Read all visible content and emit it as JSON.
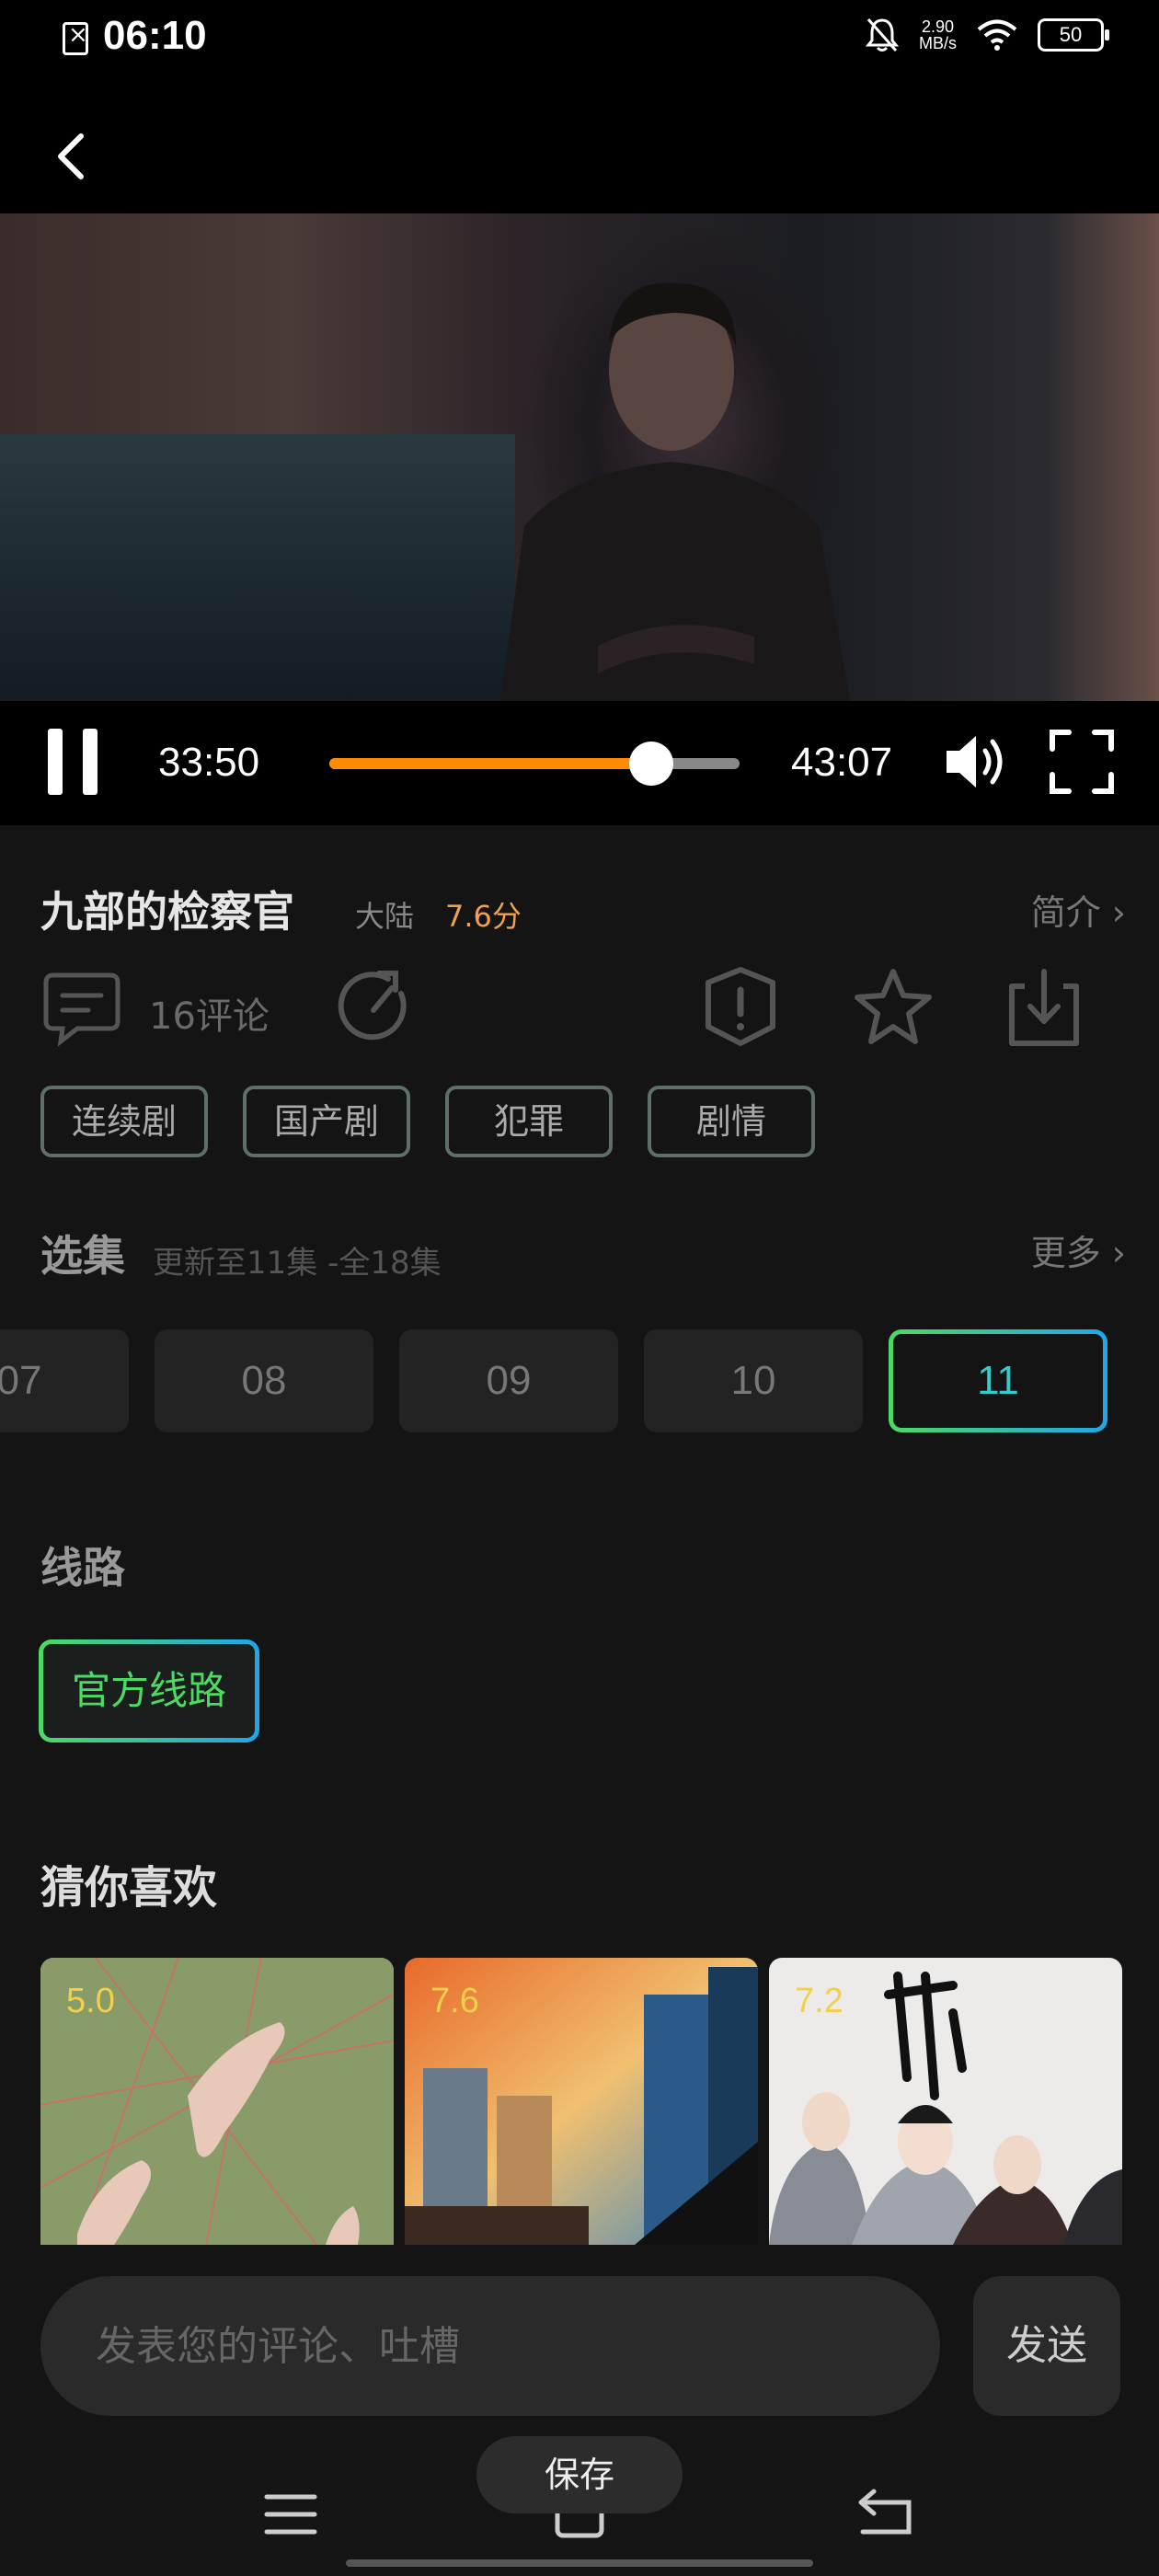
{
  "status_bar": {
    "time": "06:10",
    "net_speed_value": "2.90",
    "net_speed_unit": "MB/s",
    "battery": "50"
  },
  "player": {
    "current_time": "33:50",
    "total_time": "43:07",
    "progress": 0.785
  },
  "show": {
    "title": "九部的检察官",
    "region": "大陆",
    "score": "7.6分",
    "intro_label": "简介"
  },
  "actions": {
    "comment_count": "16评论"
  },
  "tags": [
    "连续剧",
    "国产剧",
    "犯罪",
    "剧情"
  ],
  "episodes": {
    "title": "选集",
    "update_info": "更新至11集 -全18集",
    "more_label": "更多",
    "items": [
      "07",
      "08",
      "09",
      "10",
      "11"
    ],
    "active": "11"
  },
  "route": {
    "title": "线路",
    "selected": "官方线路"
  },
  "recommend": {
    "title": "猜你喜欢",
    "items": [
      {
        "score": "5.0"
      },
      {
        "score": "7.6"
      },
      {
        "score": "7.2"
      }
    ]
  },
  "comment": {
    "placeholder": "发表您的评论、吐槽",
    "send_label": "发送"
  },
  "toast": "保存",
  "colors": {
    "accent_orange": "#ff8c00",
    "score_orange": "#f0a050",
    "accent_green": "#4cd964",
    "accent_blue": "#1ea7e8"
  }
}
